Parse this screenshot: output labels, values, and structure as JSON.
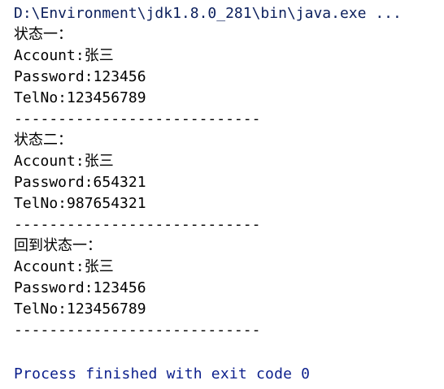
{
  "console": {
    "command_line": "D:\\Environment\\jdk1.8.0_281\\bin\\java.exe ...",
    "lines": [
      "状态一：",
      "Account:张三",
      "Password:123456",
      "TelNo:123456789",
      "----------------------------",
      "状态二：",
      "Account:张三",
      "Password:654321",
      "TelNo:987654321",
      "----------------------------",
      "回到状态一：",
      "Account:张三",
      "Password:123456",
      "TelNo:123456789",
      "----------------------------"
    ],
    "exit_message": "Process finished with exit code 0"
  }
}
